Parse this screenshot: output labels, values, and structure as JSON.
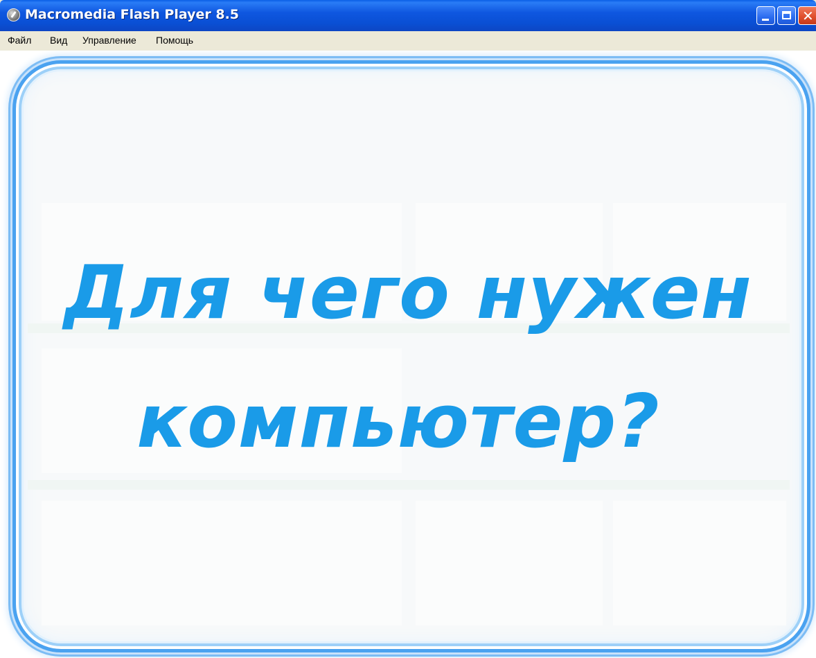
{
  "window": {
    "title": "Macromedia Flash Player 8.5",
    "controls": {
      "minimize_icon": "minimize-icon",
      "maximize_icon": "maximize-icon",
      "close_icon": "close-icon",
      "close_glyph": "✕"
    }
  },
  "menubar": {
    "items": [
      {
        "label": "Файл"
      },
      {
        "label": "Вид"
      },
      {
        "label": "Управление"
      },
      {
        "label": "Помощь"
      }
    ]
  },
  "content": {
    "heading_line1": "Для чего нужен",
    "heading_line2": "компьютер?"
  },
  "colors": {
    "titlebar": "#0a4fd4",
    "heading_text": "#1a9be8",
    "frame_border": "#4aa2f0",
    "menubar_bg": "#ece9d8"
  }
}
